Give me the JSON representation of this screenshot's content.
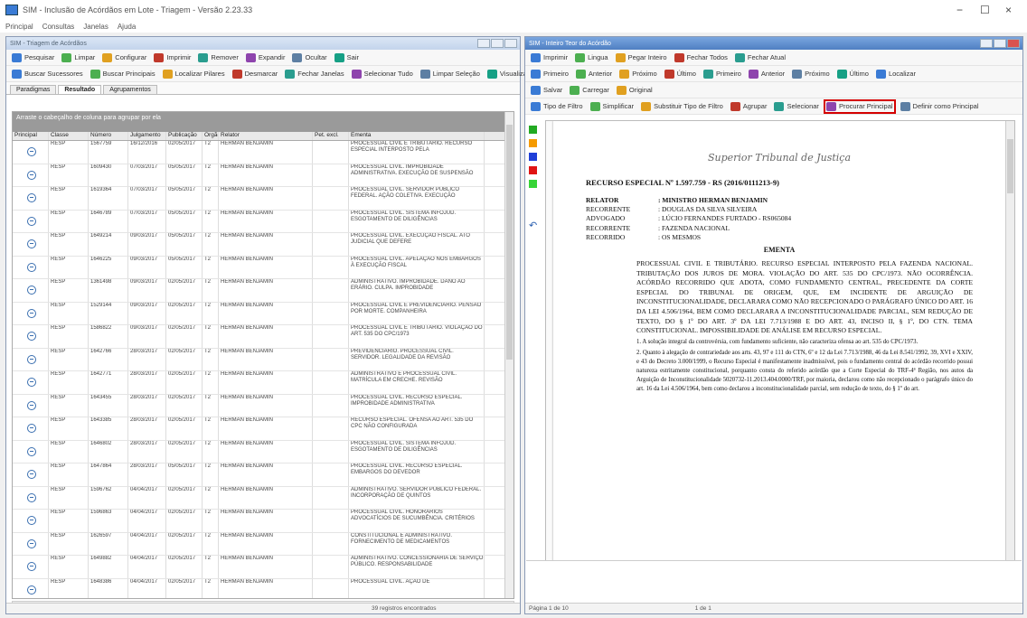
{
  "window": {
    "title": "SIM - Inclusão de Acórdãos em Lote - Triagem - Versão 2.23.33",
    "minimize": "−",
    "maximize": "☐",
    "close": "×"
  },
  "menu": [
    "Principal",
    "Consultas",
    "Janelas",
    "Ajuda"
  ],
  "left_pane": {
    "title": "SIM - Triagem de Acórdãos",
    "toolbar": [
      "Pesquisar",
      "Limpar",
      "Configurar",
      "Imprimir",
      "Remover",
      "Expandir",
      "Ocultar",
      "Sair"
    ],
    "toolbar2": [
      "Buscar Sucessores",
      "Buscar Principais",
      "Localizar Pilares",
      "Desmarcar",
      "Fechar Janelas",
      "Selecionar Tudo",
      "Limpar Seleção",
      "Visualizar"
    ],
    "tabs": [
      "Paradigmas",
      "Resultado",
      "Agrupamentos"
    ],
    "active_tab": "Resultado",
    "grid_header": "Arraste o cabeçalho de coluna para agrupar por ela",
    "columns": [
      "Principal",
      "Classe",
      "Número",
      "Julgamento",
      "Publicação",
      "Órgão",
      "Relator",
      "Pet. excl.",
      "Ementa"
    ],
    "rows": [
      [
        "",
        "RESP",
        "1567759",
        "16/12/2016",
        "02/05/2017",
        "T2",
        "HERMAN BENJAMIN",
        "",
        "PROCESSUAL CIVIL E TRIBUTÁRIO. RECURSO ESPECIAL INTERPOSTO PELA"
      ],
      [
        "",
        "RESP",
        "1609430",
        "07/03/2017",
        "05/05/2017",
        "T2",
        "HERMAN BENJAMIN",
        "",
        "PROCESSUAL CIVIL. IMPROBIDADE ADMINISTRATIVA. EXECUÇÃO DE SUSPENSÃO"
      ],
      [
        "",
        "RESP",
        "1619364",
        "07/03/2017",
        "05/05/2017",
        "T2",
        "HERMAN BENJAMIN",
        "",
        "PROCESSUAL CIVIL. SERVIDOR PÚBLICO FEDERAL. AÇÃO COLETIVA. EXECUÇÃO"
      ],
      [
        "",
        "RESP",
        "1646789",
        "07/03/2017",
        "05/05/2017",
        "T2",
        "HERMAN BENJAMIN",
        "",
        "PROCESSUAL CIVIL. SISTEMA INFOJUD. ESGOTAMENTO DE DILIGÊNCIAS"
      ],
      [
        "",
        "RESP",
        "1649214",
        "09/03/2017",
        "05/05/2017",
        "T2",
        "HERMAN BENJAMIN",
        "",
        "PROCESSUAL CIVIL. EXECUÇÃO FISCAL. ATO JUDICIAL QUE DEFERE"
      ],
      [
        "",
        "RESP",
        "1646225",
        "09/03/2017",
        "05/05/2017",
        "T2",
        "HERMAN BENJAMIN",
        "",
        "PROCESSUAL CIVIL. APELAÇÃO NOS EMBARGOS À EXECUÇÃO FISCAL"
      ],
      [
        "",
        "RESP",
        "1361498",
        "09/03/2017",
        "02/05/2017",
        "T2",
        "HERMAN BENJAMIN",
        "",
        "ADMINISTRATIVO. IMPROBIDADE. DANO AO ERÁRIO. CULPA. IMPROBIDADE"
      ],
      [
        "",
        "RESP",
        "1529144",
        "09/03/2017",
        "02/05/2017",
        "T2",
        "HERMAN BENJAMIN",
        "",
        "PROCESSUAL CIVIL E PREVIDENCIÁRIO. PENSÃO POR MORTE. COMPANHEIRA"
      ],
      [
        "",
        "RESP",
        "1586822",
        "09/03/2017",
        "02/05/2017",
        "T2",
        "HERMAN BENJAMIN",
        "",
        "PROCESSUAL CIVIL E TRIBUTÁRIO. VIOLAÇÃO DO ART. 535 DO CPC/1973"
      ],
      [
        "",
        "RESP",
        "1642766",
        "28/03/2017",
        "02/05/2017",
        "T2",
        "HERMAN BENJAMIN",
        "",
        "PREVIDENCIÁRIO. PROCESSUAL CIVIL. SERVIDOR. LEGALIDADE DA REVISÃO"
      ],
      [
        "",
        "RESP",
        "1642771",
        "28/03/2017",
        "02/05/2017",
        "T2",
        "HERMAN BENJAMIN",
        "",
        "ADMINISTRATIVO E PROCESSUAL CIVIL. MATRÍCULA EM CRECHE. REVISÃO"
      ],
      [
        "",
        "RESP",
        "1643455",
        "28/03/2017",
        "02/05/2017",
        "T2",
        "HERMAN BENJAMIN",
        "",
        "PROCESSUAL CIVIL. RECURSO ESPECIAL. IMPROBIDADE ADMINISTRATIVA"
      ],
      [
        "",
        "RESP",
        "1643385",
        "28/03/2017",
        "02/05/2017",
        "T2",
        "HERMAN BENJAMIN",
        "",
        "RECURSO ESPECIAL. OFENSA AO ART. 535 DO CPC NÃO CONFIGURADA"
      ],
      [
        "",
        "RESP",
        "1646802",
        "28/03/2017",
        "02/05/2017",
        "T2",
        "HERMAN BENJAMIN",
        "",
        "PROCESSUAL CIVIL. SISTEMA INFOJUD. ESGOTAMENTO DE DILIGÊNCIAS"
      ],
      [
        "",
        "RESP",
        "1647864",
        "28/03/2017",
        "05/05/2017",
        "T2",
        "HERMAN BENJAMIN",
        "",
        "PROCESSUAL CIVIL. RECURSO ESPECIAL. EMBARGOS DO DEVEDOR"
      ],
      [
        "",
        "RESP",
        "1596762",
        "04/04/2017",
        "02/05/2017",
        "T2",
        "HERMAN BENJAMIN",
        "",
        "ADMINISTRATIVO. SERVIDOR PÚBLICO FEDERAL. INCORPORAÇÃO DE QUINTOS"
      ],
      [
        "",
        "RESP",
        "1596863",
        "04/04/2017",
        "02/05/2017",
        "T2",
        "HERMAN BENJAMIN",
        "",
        "PROCESSUAL CIVIL. HONORÁRIOS ADVOCATÍCIOS DE SUCUMBÊNCIA. CRITÉRIOS"
      ],
      [
        "",
        "RESP",
        "1626597",
        "04/04/2017",
        "02/05/2017",
        "T2",
        "HERMAN BENJAMIN",
        "",
        "CONSTITUCIONAL E ADMINISTRATIVO. FORNECIMENTO DE MEDICAMENTOS"
      ],
      [
        "",
        "RESP",
        "1649882",
        "04/04/2017",
        "02/05/2017",
        "T2",
        "HERMAN BENJAMIN",
        "",
        "ADMINISTRATIVO. CONCESSIONÁRIA DE SERVIÇO PÚBLICO. RESPONSABILIDADE"
      ],
      [
        "",
        "RESP",
        "1648386",
        "04/04/2017",
        "02/05/2017",
        "T2",
        "HERMAN BENJAMIN",
        "",
        "PROCESSUAL CIVIL. AÇÃO DE"
      ]
    ],
    "status": "39 registros encontrados"
  },
  "right_pane": {
    "title": "SIM - Inteiro Teor do Acórdão",
    "toolbar1": [
      "Imprimir",
      "Lingua",
      "Pegar Inteiro",
      "Fechar Todos",
      "Fechar Atual"
    ],
    "toolbar2": [
      "Primeiro",
      "Anterior",
      "Próximo",
      "Último",
      "Primeiro",
      "Anterior",
      "Próximo",
      "Último",
      "Localizar"
    ],
    "toolbar3": [
      "Salvar",
      "Carregar",
      "Original"
    ],
    "toolbar4": [
      "Tipo de Filtro",
      "Simplificar",
      "Substituir Tipo de Filtro",
      "Agrupar",
      "Selecionar",
      "Procurar Principal",
      "Definir como Principal"
    ],
    "highlighted_button": "Procurar Principal",
    "swatches": [
      "#22aa22",
      "#f59a00",
      "#1f3fd8",
      "#e01414",
      "#36d436"
    ],
    "status_left": "Página 1 de 10",
    "status_right": "1 de 1",
    "document": {
      "court": "Superior Tribunal de Justiça",
      "title": "RECURSO ESPECIAL Nº 1.597.759 - RS (2016/0111213-9)",
      "parties": [
        {
          "role": "RELATOR",
          "value": ": MINISTRO HERMAN BENJAMIN"
        },
        {
          "role": "RECORRENTE",
          "value": ": DOUGLAS DA SILVA SILVEIRA"
        },
        {
          "role": "ADVOGADO",
          "value": ": LÚCIO FERNANDES FURTADO - RS065084"
        },
        {
          "role": "RECORRENTE",
          "value": ": FAZENDA NACIONAL"
        },
        {
          "role": "RECORRIDO",
          "value": ": OS MESMOS"
        }
      ],
      "ementa_label": "EMENTA",
      "ementa": "PROCESSUAL CIVIL E TRIBUTÁRIO. RECURSO ESPECIAL INTERPOSTO PELA FAZENDA NACIONAL. TRIBUTAÇÃO DOS JUROS DE MORA. VIOLAÇÃO DO ART. 535 DO CPC/1973. NÃO OCORRÊNCIA. ACÓRDÃO RECORRIDO QUE ADOTA, COMO FUNDAMENTO CENTRAL, PRECEDENTE DA CORTE ESPECIAL DO TRIBUNAL DE ORIGEM, QUE, EM INCIDENTE DE ARGUIÇÃO DE INCONSTITUCIONALIDADE, DECLARARA COMO NÃO RECEPCIONADO O PARÁGRAFO ÚNICO DO ART. 16 DA LEI 4.506/1964, BEM COMO DECLARARA A INCONSTITUCIONALIDADE PARCIAL, SEM REDUÇÃO DE TEXTO, DO § 1º DO ART. 3º DA LEI 7.713/1988 E DO ART. 43, INCISO II, § 1º, DO CTN. TEMA CONSTITUCIONAL. IMPOSSIBILIDADE DE ANÁLISE EM RECURSO ESPECIAL.",
      "p1": "1. A solução integral da controvérsia, com fundamento suficiente, não caracteriza ofensa ao art. 535 do CPC/1973.",
      "p2": "2. Quanto à alegação de contrariedade aos arts. 43, 97 e 111 do CTN, 6º e 12 da Lei 7.713/1988, 46 da Lei 8.541/1992, 39, XVI e XXIV, e 43 do Decreto 3.000/1999, o Recurso Especial é manifestamente inadmissível, pois o fundamento central do acórdão recorrido possui natureza estritamente constitucional, porquanto consta do referido acórdão que a Corte Especial do TRF-4ª Região, nos autos da Arguição de Inconstitucionalidade 5020732-11.2013.404.0000/TRF, por maioria, declarou como não recepcionado o parágrafo único do art. 16 da Lei 4.506/1964, bem como declarou a inconstitucionalidade parcial, sem redução de texto, do § 1º do art."
    }
  }
}
